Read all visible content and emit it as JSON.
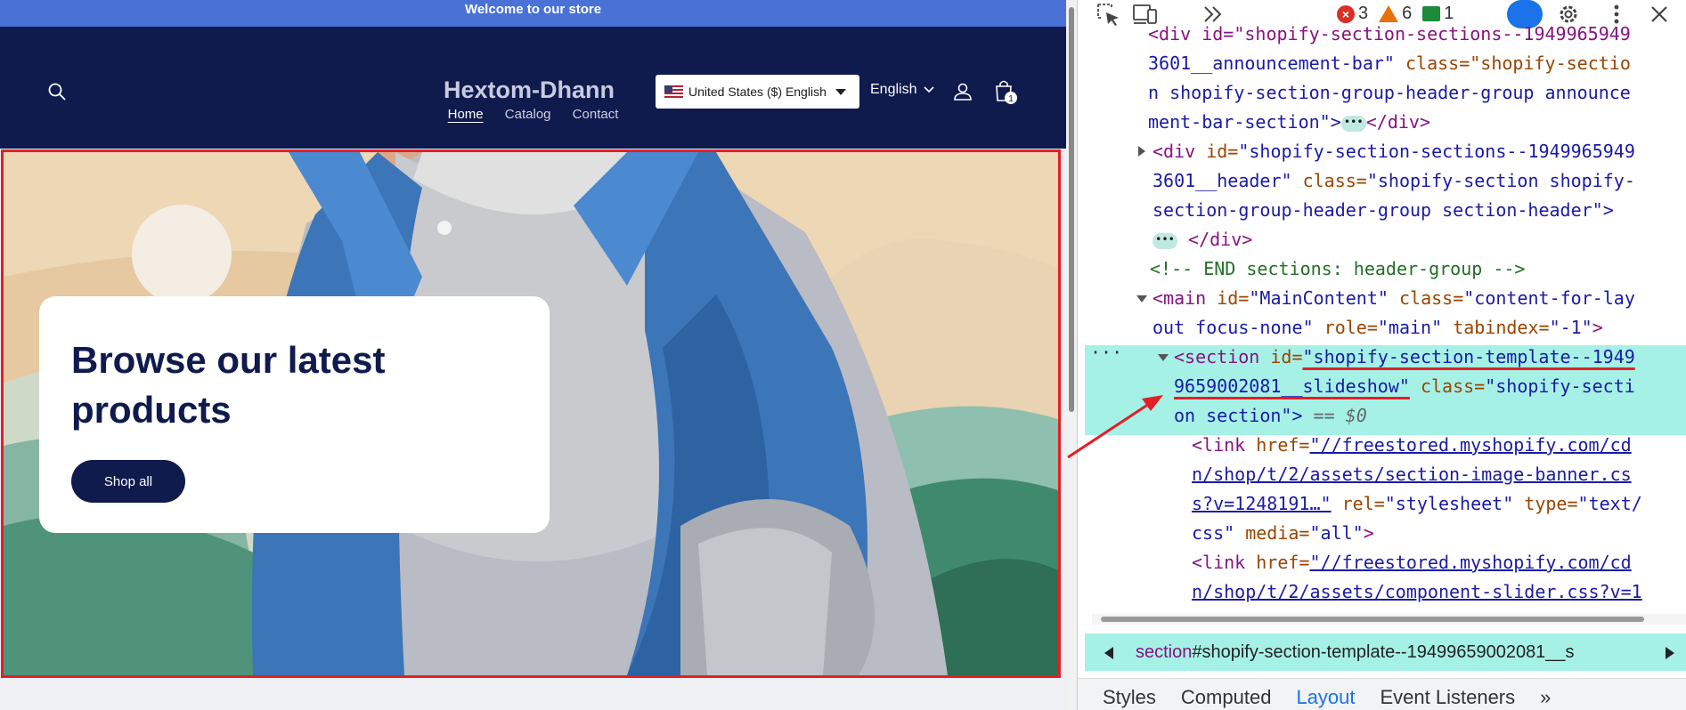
{
  "store": {
    "announcement": "Welcome to our store",
    "brand": "Hextom-Dhann",
    "country_selector": "United States ($) English",
    "language": "English",
    "cart_count": "1",
    "nav": [
      "Home",
      "Catalog",
      "Contact"
    ],
    "hero": {
      "heading": "Browse our latest products",
      "button": "Shop all"
    }
  },
  "devtools": {
    "counts": {
      "errors": "3",
      "warnings": "6",
      "messages": "1"
    },
    "dom_lines": {
      "l1_frag": "<div id=\"shopify-section-sections--1949965949",
      "l2_a": "3601__announcement-bar\"",
      "l2_b": "class=\"shopify-sectio",
      "l3": "n shopify-section-group-header-group announce",
      "l4": "ment-bar-section\">",
      "l4_end": "</div>",
      "l5_a": "<div",
      "l5_id": "id=",
      "l5_val": "\"shopify-section-sections--1949965949",
      "l6_a": "3601__header\"",
      "l6_attr": "class=",
      "l6_val": "\"shopify-section shopify-",
      "l7": "section-group-header-group section-header\">",
      "l8_end": "</div>",
      "comment": "<!-- END sections: header-group -->",
      "main_a": "<main",
      "main_b": "id=",
      "main_c": "\"MainContent\"",
      "main_d": "class=",
      "main_e": "\"content-for-lay",
      "main2_a": "out focus-none\"",
      "main2_b": "role=",
      "main2_c": "\"main\"",
      "main2_d": "tabindex=",
      "main2_e": "\"-1\"",
      "main2_f": ">",
      "sec_a": "<section",
      "sec_b": "id=",
      "sec_c": "\"shopify-section-template--1949",
      "sec2_a": "9659002081__slideshow\"",
      "sec2_b": "class=",
      "sec2_c": "\"shopify-secti",
      "sec3_a": "on section\">",
      "sec3_b": "== $0",
      "link1_a": "<link",
      "link1_b": "href=",
      "link1_c": "\"//freestored.myshopify.com/cd",
      "link2": "n/shop/t/2/assets/section-image-banner.cs",
      "link3_a": "s?v=1248191…\"",
      "link3_b": "rel=",
      "link3_c": "\"stylesheet\"",
      "link3_d": "type=",
      "link3_e": "\"text/",
      "link4_a": "css\"",
      "link4_b": "media=",
      "link4_c": "\"all\"",
      "link4_d": ">",
      "link5_a": "<link",
      "link5_b": "href=",
      "link5_c": "\"//freestored.myshopify.com/cd",
      "link6": "n/shop/t/2/assets/component-slider.css?v=1"
    },
    "breadcrumb_tag": "section",
    "breadcrumb_rest": "#shopify-section-template--19499659002081__s",
    "tabs": [
      "Styles",
      "Computed",
      "Layout",
      "Event Listeners"
    ],
    "active_tab": "Layout"
  }
}
